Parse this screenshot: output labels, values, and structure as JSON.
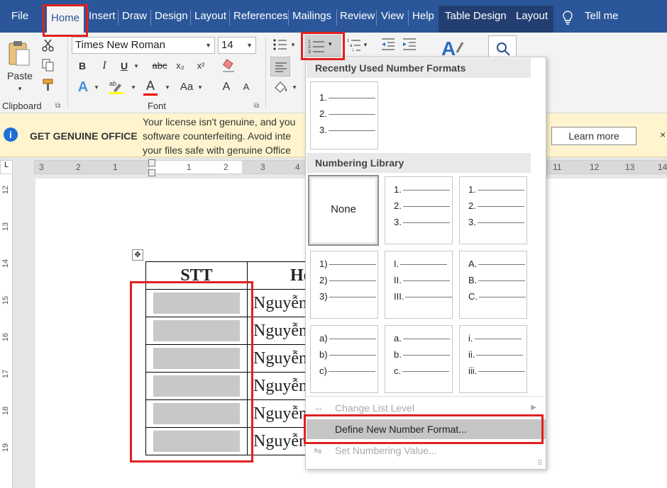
{
  "tabs": {
    "file": "File",
    "home": "Home",
    "insert": "Insert",
    "draw": "Draw",
    "design": "Design",
    "layout": "Layout",
    "references": "References",
    "mailings": "Mailings",
    "review": "Review",
    "view": "View",
    "help": "Help",
    "table_design": "Table Design",
    "table_layout": "Layout",
    "tell_me": "Tell me"
  },
  "ribbon": {
    "paste_label": "Paste",
    "font_name": "Times New Roman",
    "font_size": "14",
    "bold": "B",
    "italic": "I",
    "underline": "U",
    "strike": "abc",
    "subscript": "x₂",
    "superscript": "x²",
    "text_effects": "A",
    "font_color": "A",
    "change_case": "Aa",
    "grow_font": "A",
    "shrink_font": "A",
    "clipboard_label": "Clipboard",
    "font_label": "Font"
  },
  "message_bar": {
    "title": "GET GENUINE OFFICE",
    "line1": "Your license isn't genuine, and you",
    "line2": "software counterfeiting. Avoid inte",
    "line3": "your files safe with genuine Office",
    "learn_more": "Learn more",
    "close": "×"
  },
  "ruler": {
    "horizontal": [
      "3",
      "2",
      "1",
      "1",
      "2",
      "3",
      "4",
      "11",
      "12",
      "13",
      "14"
    ],
    "vertical": [
      "12",
      "13",
      "14",
      "15",
      "16",
      "17",
      "18",
      "19"
    ]
  },
  "document": {
    "header_stt": "STT",
    "header_name": "Họ",
    "rows": [
      "Nguyễn",
      "Nguyễn",
      "Nguyễn",
      "Nguyễn",
      "Nguyễn",
      "Nguyễn"
    ]
  },
  "dropdown": {
    "recent_header": "Recently Used Number Formats",
    "library_header": "Numbering Library",
    "recent_tile": [
      "1.",
      "2.",
      "3."
    ],
    "none_label": "None",
    "tiles": [
      [
        "1.",
        "2.",
        "3."
      ],
      [
        "1.",
        "2.",
        "3."
      ],
      [
        "1)",
        "2)",
        "3)"
      ],
      [
        "I.",
        "II.",
        "III."
      ],
      [
        "A.",
        "B.",
        "C."
      ],
      [
        "a)",
        "b)",
        "c)"
      ],
      [
        "a.",
        "b.",
        "c."
      ],
      [
        "i.",
        "ii.",
        "iii."
      ]
    ],
    "change_list_level": "Change List Level",
    "define_new": "Define New Number Format...",
    "set_value": "Set Numbering Value..."
  }
}
